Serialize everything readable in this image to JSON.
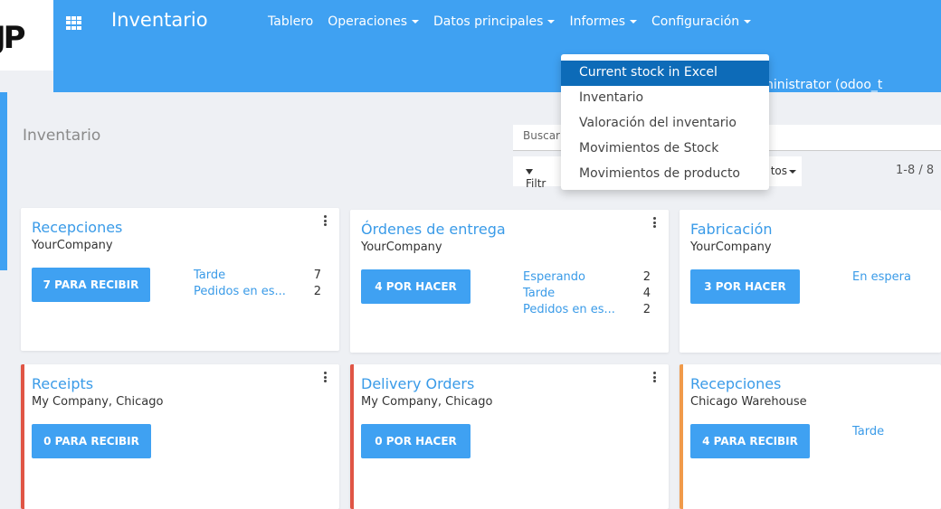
{
  "logo": {
    "text": "JP"
  },
  "header": {
    "app_title": "Inventario",
    "nav": [
      "Tablero",
      "Operaciones",
      "Datos principales",
      "Informes",
      "Configuración"
    ],
    "user": "Administrator (odoo_t"
  },
  "dropdown": {
    "items": [
      "Current stock in Excel",
      "Inventario",
      "Valoración del inventario",
      "Movimientos de Stock",
      "Movimientos de producto"
    ],
    "active_index": 0
  },
  "control": {
    "page_title": "Inventario",
    "search_placeholder": "Buscar",
    "filters_label": "Filtr",
    "favorites_label": "tos",
    "pager": "1-8 / 8"
  },
  "cards": [
    {
      "title": "Recepciones",
      "company": "YourCompany",
      "button": "7 PARA RECIBIR",
      "stats": [
        {
          "label": "Tarde",
          "count": "7"
        },
        {
          "label": "Pedidos en es...",
          "count": "2"
        }
      ]
    },
    {
      "title": "Órdenes de entrega",
      "company": "YourCompany",
      "button": "4 POR HACER",
      "stats": [
        {
          "label": "Esperando",
          "count": "2"
        },
        {
          "label": "Tarde",
          "count": "4"
        },
        {
          "label": "Pedidos en es...",
          "count": "2"
        }
      ]
    },
    {
      "title": "Fabricación",
      "company": "YourCompany",
      "button": "3 POR HACER",
      "stats": [
        {
          "label": "En espera",
          "count": ""
        }
      ]
    },
    {
      "title": "Receipts",
      "company": "My Company, Chicago",
      "button": "0 PARA RECIBIR",
      "stats": []
    },
    {
      "title": "Delivery Orders",
      "company": "My Company, Chicago",
      "button": "0 POR HACER",
      "stats": []
    },
    {
      "title": "Recepciones",
      "company": "Chicago Warehouse",
      "button": "4 PARA RECIBIR",
      "stats": [
        {
          "label": "Tarde",
          "count": ""
        }
      ]
    }
  ],
  "colors": {
    "primary": "#3fa1f2",
    "dropdown_active": "#0d6bb8",
    "card_red": "#e05545",
    "card_orange": "#f09a4a",
    "link": "#3a9be8"
  }
}
